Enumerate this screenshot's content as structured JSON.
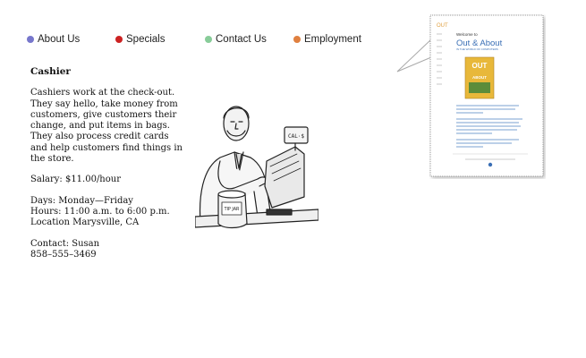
{
  "nav": {
    "items": [
      {
        "label": "About Us",
        "color": "#7777cc"
      },
      {
        "label": "Specials",
        "color": "#cc2222"
      },
      {
        "label": "Contact Us",
        "color": "#88cc99"
      },
      {
        "label": "Employment",
        "color": "#e08040"
      }
    ]
  },
  "job": {
    "title": "Cashier",
    "description": "Cashiers work at the check-out. They say hello, take money from customers, give customers their change, and put items in bags. They also process credit cards and help customers find things in the store.",
    "salary": "Salary: $11.00/hour",
    "days": "Days: Monday—Friday",
    "hours": "Hours: 11:00 a.m. to 6:00 p.m.",
    "location": "Location Marysville, CA",
    "contact_name": "Contact: Susan",
    "contact_phone": "858–555–3469"
  },
  "illustration": {
    "register_sign": "CAL·$",
    "jar_label": "TIP JAR"
  },
  "preview": {
    "logo": "OUT",
    "welcome": "Welcome to",
    "title": "Out & About",
    "subtitle": "IN THE WORLD OF COMPUTERS",
    "book_word_top": "OUT",
    "book_word_bottom": "ABOUT"
  }
}
